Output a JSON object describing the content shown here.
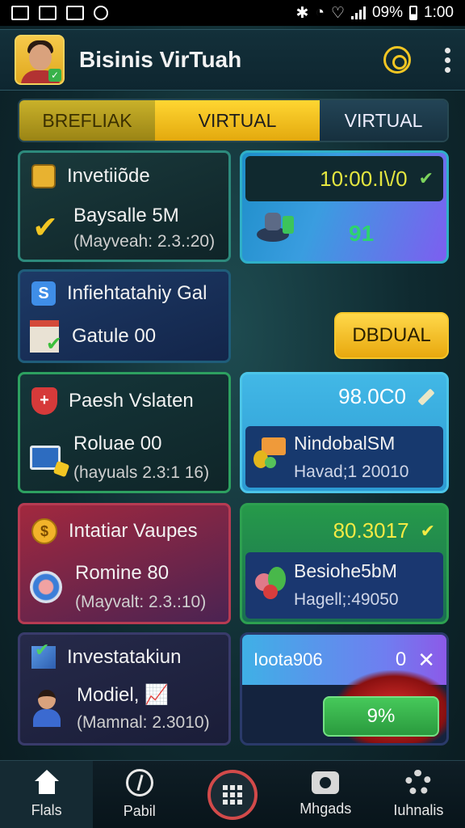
{
  "status_bar": {
    "battery_percent": "09%",
    "time": "1:00"
  },
  "header": {
    "app_title": "Bisinis VirTuah"
  },
  "tabs": [
    {
      "label": "BREFLIAK"
    },
    {
      "label": "VIRTUAL"
    },
    {
      "label": "VIRTUAL"
    }
  ],
  "cards": {
    "c1": {
      "title": "Invetiiõde",
      "line1": "Baysalle 5M",
      "line2": "(Mayveah: 2.3.:20)"
    },
    "c2": {
      "title": "Infiehtatahiy Gal",
      "line1": "Gatule 00"
    },
    "c3": {
      "title": "Paesh Vslaten",
      "line1": "Roluae 00",
      "line2": "(hayuals 2.3:1 16)"
    },
    "c4": {
      "title": "Intatiar Vaupes",
      "line1": "Romine 80",
      "line2": "(Mayvalt: 2.3.:10)"
    },
    "c5": {
      "title": "Investatakiun",
      "line1": "Modiel,",
      "line2": "(Mamnal: 2.3010)"
    }
  },
  "right": {
    "r1": {
      "value": "10:00.I\\/0",
      "sub_value": "91"
    },
    "r2": {
      "button": "DBDUAL"
    },
    "r3": {
      "value": "98.0C0",
      "line1": "NindobalSM",
      "line2": "Havad;1 20010"
    },
    "r4": {
      "value": "80.3017",
      "line1": "Besiohe5bM",
      "line2": "Hagell;:49050"
    },
    "r5": {
      "label": "Ioota906",
      "zero": "0",
      "button": "9%"
    }
  },
  "bottom_nav": [
    {
      "label": "Flals",
      "icon": "home-icon"
    },
    {
      "label": "Pabil",
      "icon": "compass-icon"
    },
    {
      "label": "",
      "icon": "grid-icon"
    },
    {
      "label": "Mhgads",
      "icon": "camera-icon"
    },
    {
      "label": "Iuhnalis",
      "icon": "gear-icon"
    }
  ]
}
